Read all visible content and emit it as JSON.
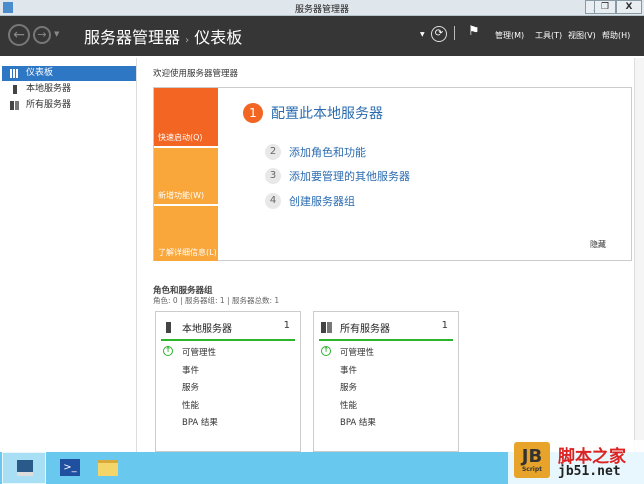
{
  "window": {
    "title": "服务器管理器",
    "min": "_",
    "max": "❐",
    "close": "X"
  },
  "header": {
    "app": "服务器管理器",
    "sep": "›",
    "page": "仪表板",
    "menus": [
      "管理(M)",
      "工具(T)",
      "视图(V)",
      "帮助(H)"
    ]
  },
  "sidebar": {
    "items": [
      {
        "label": "仪表板",
        "icon": "dashboard-icon"
      },
      {
        "label": "本地服务器",
        "icon": "server-icon"
      },
      {
        "label": "所有服务器",
        "icon": "servers-icon"
      }
    ]
  },
  "main": {
    "welcome": "欢迎使用服务器管理器",
    "quickstart": {
      "tabs": [
        "快速启动(Q)",
        "新增功能(W)",
        "了解详细信息(L)"
      ],
      "steps": [
        {
          "n": "1",
          "label": "配置此本地服务器"
        },
        {
          "n": "2",
          "label": "添加角色和功能"
        },
        {
          "n": "3",
          "label": "添加要管理的其他服务器"
        },
        {
          "n": "4",
          "label": "创建服务器组"
        }
      ],
      "hide": "隐藏"
    },
    "groups": {
      "title": "角色和服务器组",
      "summary": "角色: 0 | 服务器组: 1 | 服务器总数: 1",
      "tiles": [
        {
          "title": "本地服务器",
          "count": "1",
          "rows": [
            "可管理性",
            "事件",
            "服务",
            "性能",
            "BPA 结果"
          ]
        },
        {
          "title": "所有服务器",
          "count": "1",
          "rows": [
            "可管理性",
            "事件",
            "服务",
            "性能",
            "BPA 结果"
          ]
        }
      ]
    }
  },
  "watermark": {
    "logo": "JB",
    "script": "Script",
    "site": "脚本之家",
    "url": "jb51.net"
  },
  "colors": {
    "accent": "#f26522",
    "quick_light": "#f9a63a",
    "selection": "#2e77c4",
    "ok": "#2cb52c",
    "taskbar": "#69c8ee"
  }
}
